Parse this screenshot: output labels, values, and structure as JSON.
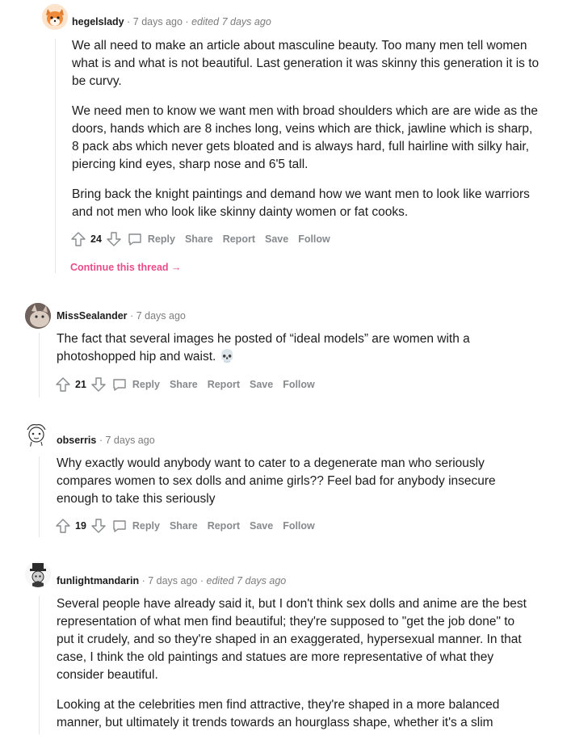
{
  "comments": [
    {
      "username": "hegelslady",
      "separator": "·",
      "time": "7 days ago",
      "edited": "edited 7 days ago",
      "paragraphs": [
        "We all need to make an article about masculine beauty. Too many men tell women what is and what is not beautiful. Last generation it was skinny this generation it is to be curvy.",
        "We need men to know we want men with broad shoulders which are are wide as the doors, hands which are 8 inches long, veins which are thick, jawline which is sharp, 8 pack abs which never gets bloated and is always hard, full hairline with silky hair, piercing kind eyes, sharp nose and 6'5 tall.",
        "Bring back the knight paintings and demand how we want men to look like warriors and not men who look like skinny dainty women or fat cooks."
      ],
      "score": "24",
      "continue_thread": "Continue this thread →"
    },
    {
      "username": "MissSealander",
      "separator": "·",
      "time": "7 days ago",
      "paragraphs": [
        "The fact that several images he posted of “ideal models” are women with a photoshopped hip and waist. 💀"
      ],
      "score": "21"
    },
    {
      "username": "obserris",
      "separator": "·",
      "time": "7 days ago",
      "paragraphs": [
        "Why exactly would anybody want to cater to a degenerate man who seriously compares women to sex dolls and anime girls?? Feel bad for anybody insecure enough to take this seriously"
      ],
      "score": "19"
    },
    {
      "username": "funlightmandarin",
      "separator": "·",
      "time": "7 days ago",
      "edited": "edited 7 days ago",
      "paragraphs": [
        "Several people have already said it, but I don't think sex dolls and anime are the best representation of what men find beautiful; they're supposed to \"get the job done\" to put it crudely, and so they're shaped in an exaggerated, hypersexual manner. In that case, I think the old paintings and statues are more representative of what they consider beautiful.",
        "Looking at the celebrities men find attractive, they're shaped in a more balanced manner, but ultimately it trends towards an hourglass shape, whether it's a slim"
      ]
    }
  ],
  "actions": {
    "reply": "Reply",
    "share": "Share",
    "report": "Report",
    "save": "Save",
    "follow": "Follow"
  },
  "colors": {
    "continue_link": "#ea4c89",
    "muted": "#878a8c",
    "text": "#1c1c1c"
  }
}
